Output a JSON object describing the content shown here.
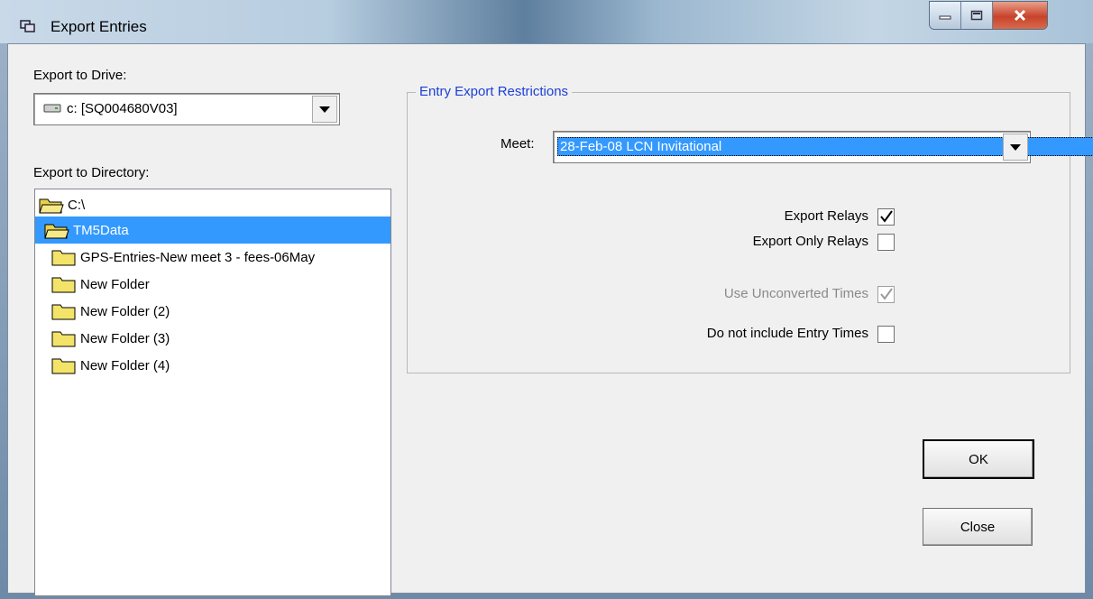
{
  "window": {
    "title": "Export Entries"
  },
  "titlebar_buttons": {
    "minimize": "minimize-icon",
    "maximize": "maximize-icon",
    "close": "close-icon"
  },
  "drive": {
    "label": "Export to Drive:",
    "value": "c: [SQ004680V03]"
  },
  "directory": {
    "label": "Export to Directory:",
    "items": [
      {
        "name": "C:\\",
        "selected": false
      },
      {
        "name": "TM5Data",
        "selected": true
      },
      {
        "name": "GPS-Entries-New meet 3 - fees-06May",
        "selected": false
      },
      {
        "name": "New Folder",
        "selected": false
      },
      {
        "name": "New Folder (2)",
        "selected": false
      },
      {
        "name": "New Folder (3)",
        "selected": false
      },
      {
        "name": "New Folder (4)",
        "selected": false
      }
    ]
  },
  "restrictions": {
    "title": "Entry Export Restrictions",
    "meet_label": "Meet:",
    "meet_value": "28-Feb-08 LCN Invitational",
    "export_relays": {
      "label": "Export Relays",
      "checked": true,
      "enabled": true
    },
    "export_only_relays": {
      "label": "Export Only Relays",
      "checked": false,
      "enabled": true
    },
    "unconverted_times": {
      "label": "Use Unconverted Times",
      "checked": true,
      "enabled": false
    },
    "no_entry_times": {
      "label": "Do not include Entry Times",
      "checked": false,
      "enabled": true
    }
  },
  "buttons": {
    "ok": "OK",
    "close": "Close"
  },
  "colors": {
    "selection": "#3399ff",
    "group_title": "#1c3fd6",
    "disabled_text": "#8a8a8a"
  }
}
